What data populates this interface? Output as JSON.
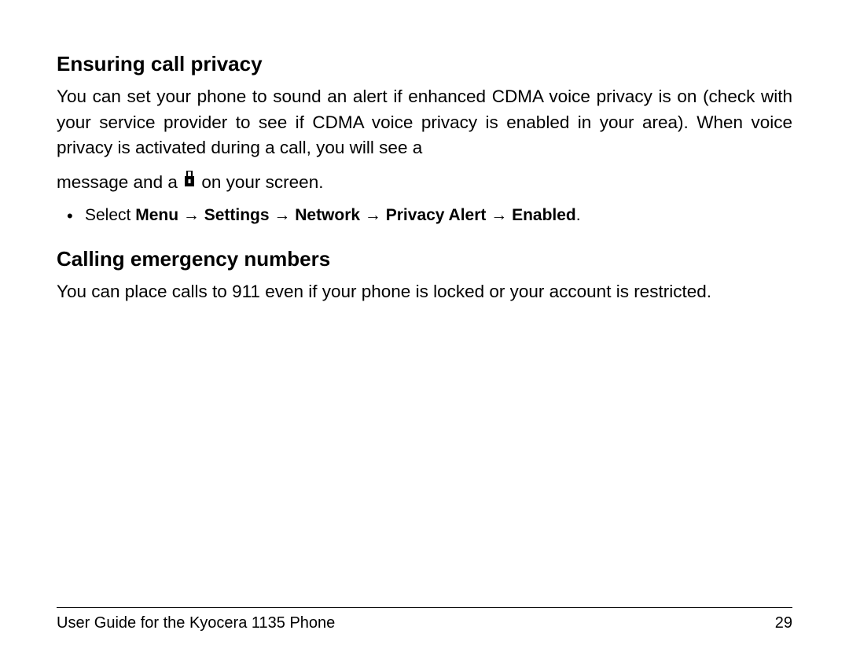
{
  "section1": {
    "heading": "Ensuring call privacy",
    "para_part1": "You can set your phone to sound an alert if enhanced CDMA voice privacy is on (check with your service provider to see if CDMA voice privacy is enabled in your area). When voice privacy is activated during a call, you will see a",
    "para_part2_pre": "message and a ",
    "para_part2_post": " on your screen.",
    "bullet_prefix": "Select ",
    "bullet_menu": "Menu",
    "bullet_arrow": " → ",
    "bullet_settings": "Settings",
    "bullet_network": "Network",
    "bullet_privacy": "Privacy Alert",
    "bullet_enabled": "Enabled",
    "bullet_period": "."
  },
  "section2": {
    "heading": "Calling emergency numbers",
    "para": "You can place calls to 911 even if your phone is locked or your account is restricted."
  },
  "footer": {
    "title": "User Guide for the Kyocera 1135 Phone",
    "page": "29"
  }
}
